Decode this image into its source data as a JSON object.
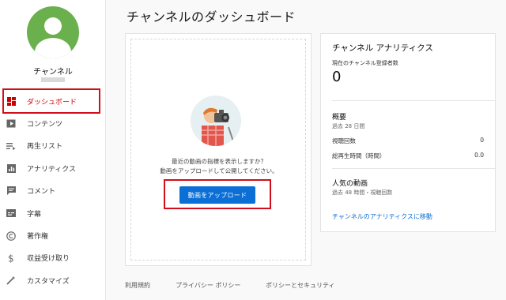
{
  "page": {
    "title": "チャンネルのダッシュボード"
  },
  "sidebar": {
    "channel_name": "チャンネル",
    "items": [
      {
        "label": "ダッシュボード",
        "icon": "dashboard-icon",
        "active": true
      },
      {
        "label": "コンテンツ",
        "icon": "video-library-icon"
      },
      {
        "label": "再生リスト",
        "icon": "playlist-icon"
      },
      {
        "label": "アナリティクス",
        "icon": "analytics-icon"
      },
      {
        "label": "コメント",
        "icon": "comment-icon"
      },
      {
        "label": "字幕",
        "icon": "subtitles-icon"
      },
      {
        "label": "著作権",
        "icon": "copyright-icon"
      },
      {
        "label": "収益受け取り",
        "icon": "dollar-icon"
      },
      {
        "label": "カスタマイズ",
        "icon": "magic-wand-icon"
      }
    ]
  },
  "upload_card": {
    "prompt_line1": "最近の動画の指標を表示しますか？",
    "prompt_line2": "動画をアップロードして公開してください。",
    "button_label": "動画をアップロード"
  },
  "analytics": {
    "title": "チャンネル アナリティクス",
    "subscribers_label": "現在のチャンネル登録者数",
    "subscribers_value": "0",
    "summary_title": "概要",
    "summary_period": "過去 28 日間",
    "views_label": "視聴回数",
    "views_value": "0",
    "watch_time_label": "総再生時間（時間）",
    "watch_time_value": "0.0",
    "popular_title": "人気の動画",
    "popular_period": "過去 48 時間・視聴回数",
    "link_label": "チャンネルのアナリティクスに移動"
  },
  "footer": {
    "terms": "利用規約",
    "privacy": "プライバシー ポリシー",
    "policy_safety": "ポリシーとセキュリティ"
  },
  "colors": {
    "accent": "#0b6fd6",
    "active": "#cc0000",
    "highlight": "#d10f1a",
    "avatar": "#6ab04c"
  }
}
